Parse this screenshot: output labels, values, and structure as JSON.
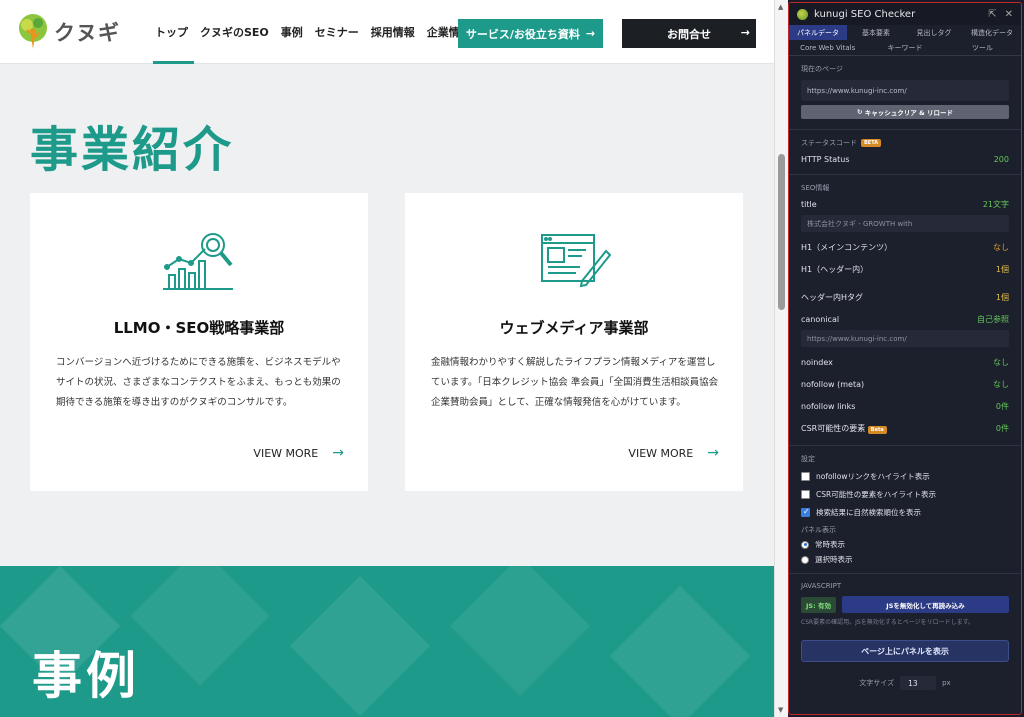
{
  "site": {
    "logo_text": "クヌギ",
    "nav": [
      "トップ",
      "クヌギのSEO",
      "事例",
      "セミナー",
      "採用情報",
      "企業情報"
    ],
    "service_button": "サービス/お役立ち資料",
    "contact_button": "お問合せ",
    "arrow": "→",
    "section_title": "事業紹介",
    "cards": [
      {
        "title": "LLMO・SEO戦略事業部",
        "desc": "コンバージョンへ近づけるためにできる施策を、ビジネスモデルやサイトの状況、さまざまなコンテクストをふまえ、もっとも効果の期待できる施策を導き出すのがクヌギのコンサルです。",
        "more": "VIEW MORE"
      },
      {
        "title": "ウェブメディア事業部",
        "desc": "金融情報わかりやすく解説したライフプラン情報メディアを運営しています。「日本クレジット協会 準会員」「全国消費生活相談員協会 企業賛助会員」として、正確な情報発信を心がけています。",
        "more": "VIEW MORE"
      }
    ],
    "cases_title": "事例"
  },
  "panel": {
    "title": "kunugi SEO Checker",
    "pin": "⇱",
    "close": "✕",
    "tabs_row1": [
      "パネルデータ",
      "基本要素",
      "見出しタグ",
      "構造化データ"
    ],
    "tabs_row2": [
      "Core Web Vitals",
      "キーワード",
      "ツール"
    ],
    "current_page_label": "現在のページ",
    "current_url": "https://www.kunugi-inc.com/",
    "cache_button": "キャッシュクリア & リロード",
    "status_label": "ステータスコード",
    "beta": "BETA",
    "http_status_label": "HTTP Status",
    "http_status_value": "200",
    "seo_label": "SEO情報",
    "title_label": "title",
    "title_count": "21文字",
    "title_value": "株式会社クヌギ - GROWTH with",
    "h1_main_label": "H1（メインコンテンツ）",
    "h1_main_value": "なし",
    "h1_header_label": "H1（ヘッダー内）",
    "h1_header_value": "1個",
    "header_h_label": "ヘッダー内Hタグ",
    "header_h_value": "1個",
    "canonical_label": "canonical",
    "canonical_value": "自己参照",
    "canonical_url": "https://www.kunugi-inc.com/",
    "noindex_label": "noindex",
    "noindex_value": "なし",
    "nofollow_meta_label": "nofollow (meta)",
    "nofollow_meta_value": "なし",
    "nofollow_links_label": "nofollow links",
    "nofollow_links_value": "0件",
    "csr_label": "CSR可能性の要素",
    "csr_badge": "Beta",
    "csr_value": "0件",
    "settings_label": "設定",
    "settings": [
      {
        "label": "nofollowリンクをハイライト表示",
        "checked": false
      },
      {
        "label": "CSR可能性の要素をハイライト表示",
        "checked": false
      },
      {
        "label": "検索結果に自然検索順位を表示",
        "checked": true
      }
    ],
    "panel_display_label": "パネル表示",
    "radios": [
      {
        "label": "常時表示",
        "on": true
      },
      {
        "label": "選択時表示",
        "on": false
      }
    ],
    "js_label": "JAVASCRIPT",
    "js_badge": "JS: 有効",
    "js_button": "JSを無効化して再読み込み",
    "js_note": "CSR要素の確認用。JSを無効化するとページをリロードします。",
    "show_panel_button": "ページ上にパネルを表示",
    "font_size_label": "文字サイズ",
    "font_size_value": "13",
    "font_size_unit": "px"
  },
  "colors": {
    "brand_teal": "#1e9a8a",
    "panel_bg": "#1c1f2c",
    "panel_border": "#c0282a",
    "ok_green": "#64c95a",
    "warn_orange": "#e0a036"
  }
}
